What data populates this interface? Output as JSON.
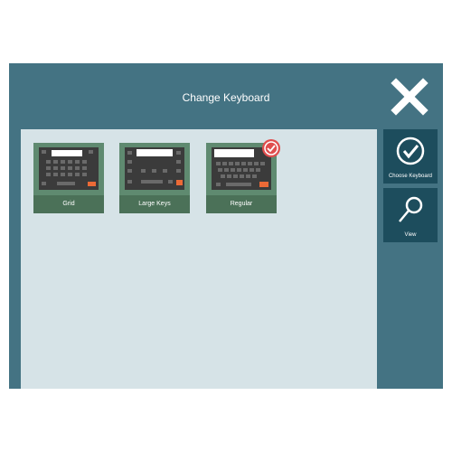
{
  "window": {
    "title": "Change Keyboard"
  },
  "keyboards": [
    {
      "label": "Grid",
      "selected": false
    },
    {
      "label": "Large Keys",
      "selected": false
    },
    {
      "label": "Regular",
      "selected": true
    }
  ],
  "sidebar": {
    "choose_label": "Choose Keyboard",
    "view_label": "View"
  },
  "icons": {
    "close": "close-icon",
    "choose": "checkmark-circle-icon",
    "view": "magnifier-icon",
    "selected": "checkmark-badge-icon"
  },
  "colors": {
    "background": "#447383",
    "panel": "#d6e3e7",
    "tile": "#5f8a70",
    "tile_label": "#4b7158",
    "side_button": "#1d4d5d",
    "accent": "#ec6a36",
    "selected_badge": "#e04d4d"
  }
}
